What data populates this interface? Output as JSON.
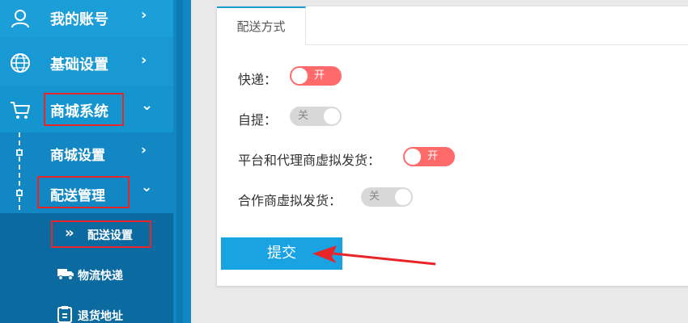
{
  "sidebar": {
    "top_items": [
      {
        "label": "我的账号",
        "icon": "user-icon",
        "chevron": "›"
      },
      {
        "label": "基础设置",
        "icon": "globe-icon",
        "chevron": "›"
      },
      {
        "label": "商城系统",
        "icon": "cart-icon",
        "chevron": "⌄"
      }
    ],
    "sub_items": [
      {
        "label": "商城设置",
        "chevron": "›"
      },
      {
        "label": "配送管理",
        "chevron": "⌄"
      }
    ],
    "leaf_items": [
      {
        "label": "配送设置",
        "icon": "double-chevron-icon",
        "glyph": "»"
      },
      {
        "label": "物流快递",
        "icon": "truck-icon"
      },
      {
        "label": "退货地址",
        "icon": "return-address-icon"
      }
    ]
  },
  "main": {
    "tab": "配送方式",
    "options": [
      {
        "label": "快递：",
        "state": "开",
        "on": true
      },
      {
        "label": "自提：",
        "state": "关",
        "on": false
      },
      {
        "label": "平台和代理商虚拟发货：",
        "state": "开",
        "on": true
      },
      {
        "label": "合作商虚拟发货：",
        "state": "关",
        "on": false
      }
    ],
    "submit": "提交"
  },
  "colors": {
    "sidebar_bg": "#1899d4",
    "leaf_bg": "#0b6aa0",
    "highlight": "#e8262a",
    "toggle_on": "#ff6b6b",
    "toggle_off": "#d8d8d8",
    "submit_bg": "#1aa3e3"
  }
}
